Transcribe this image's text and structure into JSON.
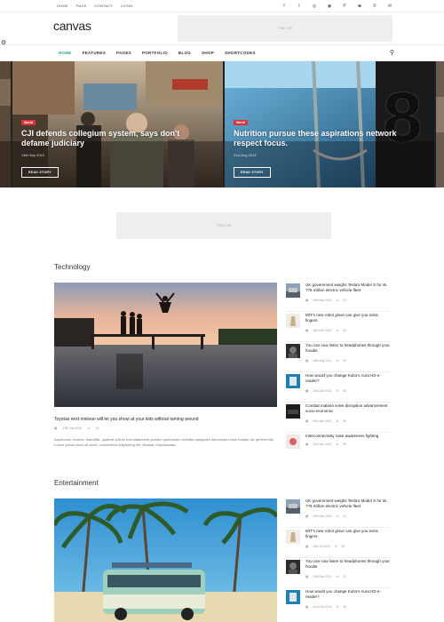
{
  "top_nav": [
    "HOME",
    "PAGE",
    "CONTACT",
    "LOGIN"
  ],
  "social_icons": [
    "facebook-icon",
    "twitter-icon",
    "dribbble-icon",
    "github-icon",
    "pinterest-icon",
    "instagram-icon",
    "phone-icon",
    "mail-icon"
  ],
  "social_glyphs": [
    "f",
    "t",
    "◎",
    "◉",
    "P",
    "◙",
    "✆",
    "✉"
  ],
  "logo": "canvas",
  "ad_top": "728 × 90",
  "ad_mid": "728 × 90",
  "main_nav": [
    "HOME",
    "FEATURES",
    "PAGES",
    "PORTFOLIO",
    "BLOG",
    "SHOP",
    "SHORTCODES"
  ],
  "slides": [
    {
      "category": "World",
      "title": "CJI defends collegium system, says don't defame judiciary",
      "date": "14th Sep 2014",
      "button": "READ STORY"
    },
    {
      "category": "World",
      "title": "Nutrition pursue these aspirations network respect focus.",
      "date": "21st Aug 2014",
      "button": "READ STORY"
    }
  ],
  "technology": {
    "heading": "Technology",
    "main_title": "Toyotas next minivan will let you shout at your kids without turning around",
    "main_date": "17th Jan 2014",
    "main_comments": "21",
    "excerpt": "Asperiores, tenetur, blanditiis, quaerat odit ex exercitationem pariatur quibusdam veritatis quisquam laboriosam esse beatae hic perferendis. Lorem ipsum dolor sit amet, consectetur adipisicing elit. Beatae, repudiandae.",
    "side": [
      {
        "title": "UK government weighs Tesla's Model S for its ??5 million electric vehicle fleet",
        "date": "10th Nov 2014",
        "comments": "21"
      },
      {
        "title": "MIT's new robot glove can give you extra fingers",
        "date": "11th Dec 2013",
        "comments": "43"
      },
      {
        "title": "You can now listen to headphones through your hoodie",
        "date": "18th July 2014",
        "comments": "90"
      },
      {
        "title": "How would you change Kobo's Aura HD e-reader?",
        "date": "23rd Jan 2014",
        "comments": "35"
      },
      {
        "title": "Combat malaria solve disruption advancement socio-economic",
        "date": "23rd Jan 2014",
        "comments": "35"
      },
      {
        "title": "Interconnectivity raise awareness fighting",
        "date": "23rd Jan 2014",
        "comments": "35"
      }
    ]
  },
  "entertainment": {
    "heading": "Entertainment",
    "side": [
      {
        "title": "UK government weighs Tesla's Model S for its ??5 million electric vehicle fleet",
        "date": "10th Nov 2014",
        "comments": "21"
      },
      {
        "title": "MIT's new robot glove can give you extra fingers",
        "date": "11th Jul 2013",
        "comments": "54"
      },
      {
        "title": "You can now listen to headphones through your hoodie",
        "date": "24th Nov 2014",
        "comments": "12"
      },
      {
        "title": "How would you change Kobo's Aura HD e-reader?",
        "date": "22nd Oct 2014",
        "comments": "35"
      }
    ]
  },
  "colors": {
    "accent": "#1aa699",
    "category": "#d9323a"
  }
}
